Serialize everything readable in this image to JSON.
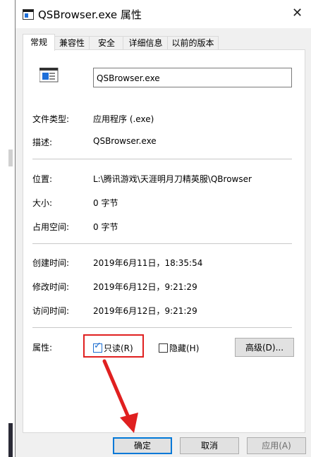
{
  "window": {
    "title": "QSBrowser.exe 属性",
    "close_glyph": "✕"
  },
  "tabs": [
    "常规",
    "兼容性",
    "安全",
    "详细信息",
    "以前的版本"
  ],
  "file": {
    "name": "QSBrowser.exe",
    "icon": "exe-file-icon"
  },
  "info": {
    "type_label": "文件类型:",
    "type_value": "应用程序 (.exe)",
    "desc_label": "描述:",
    "desc_value": "QSBrowser.exe",
    "location_label": "位置:",
    "location_value": "L:\\腾讯游戏\\天涯明月刀精英服\\QBrowser",
    "size_label": "大小:",
    "size_value": "0 字节",
    "disk_label": "占用空间:",
    "disk_value": "0 字节",
    "created_label": "创建时间:",
    "created_value": "2019年6月11日，18:35:54",
    "modified_label": "修改时间:",
    "modified_value": "2019年6月12日，9:21:29",
    "accessed_label": "访问时间:",
    "accessed_value": "2019年6月12日，9:21:29"
  },
  "attributes": {
    "label": "属性:",
    "readonly_label": "只读(R)",
    "readonly_checked": true,
    "hidden_label": "隐藏(H)",
    "hidden_checked": false,
    "advanced_label": "高级(D)..."
  },
  "buttons": {
    "ok": "确定",
    "cancel": "取消",
    "apply": "应用(A)"
  },
  "colors": {
    "highlight_box": "#e02020",
    "arrow": "#e02020",
    "focus": "#0078d7"
  }
}
